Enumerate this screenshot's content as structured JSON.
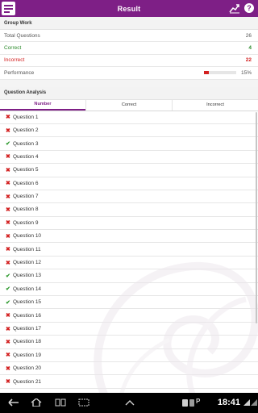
{
  "app": {
    "title": "Result",
    "accent_color": "#7e1f86",
    "icons": {
      "menu": "app-menu-icon",
      "chart": "trend-chart-icon",
      "help": "help-icon"
    }
  },
  "summary": {
    "header": "Group Work",
    "rows": [
      {
        "label": "Total Questions",
        "value": "26",
        "color": "#555555"
      },
      {
        "label": "Correct",
        "value": "4",
        "color": "#2b8a2b"
      },
      {
        "label": "Incorrect",
        "value": "22",
        "color": "#d32020"
      }
    ],
    "performance": {
      "label": "Performance",
      "value": "15%",
      "fraction": 0.15
    }
  },
  "analysis": {
    "header": "Question Analysis",
    "tabs": [
      "Number",
      "Correct",
      "Incorrect"
    ],
    "questions": [
      {
        "label": "Question 1",
        "correct": false
      },
      {
        "label": "Question 2",
        "correct": false
      },
      {
        "label": "Question 3",
        "correct": true
      },
      {
        "label": "Question 4",
        "correct": false
      },
      {
        "label": "Question 5",
        "correct": false
      },
      {
        "label": "Question 6",
        "correct": false
      },
      {
        "label": "Question 7",
        "correct": false
      },
      {
        "label": "Question 8",
        "correct": false
      },
      {
        "label": "Question 9",
        "correct": false
      },
      {
        "label": "Question 10",
        "correct": false
      },
      {
        "label": "Question 11",
        "correct": false
      },
      {
        "label": "Question 12",
        "correct": false
      },
      {
        "label": "Question 13",
        "correct": true
      },
      {
        "label": "Question 14",
        "correct": true
      },
      {
        "label": "Question 15",
        "correct": true
      },
      {
        "label": "Question 16",
        "correct": false
      },
      {
        "label": "Question 17",
        "correct": false
      },
      {
        "label": "Question 18",
        "correct": false
      },
      {
        "label": "Question 19",
        "correct": false
      },
      {
        "label": "Question 20",
        "correct": false
      },
      {
        "label": "Question 21",
        "correct": false
      }
    ]
  },
  "system_bar": {
    "time": "18:41",
    "icons": [
      "back-icon",
      "home-icon",
      "recent-apps-icon",
      "screenshot-icon",
      "up-arrow-icon",
      "battery-icon",
      "sd-card-icon",
      "notification-p-icon",
      "wifi-icon",
      "signal-icon"
    ]
  }
}
